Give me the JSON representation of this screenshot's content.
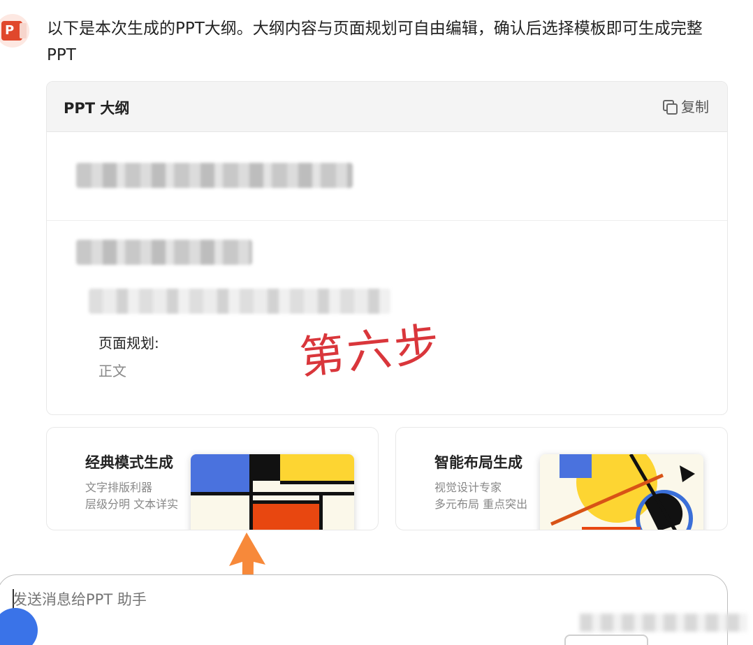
{
  "intro_text": "以下是本次生成的PPT大纲。大纲内容与页面规划可自由编辑，确认后选择模板即可生成完整PPT",
  "outline": {
    "title": "PPT 大纲",
    "copy_label": "复制",
    "page_plan_label": "页面规划:",
    "page_plan_value": "正文"
  },
  "annotation": "第六步",
  "modes": [
    {
      "title": "经典模式生成",
      "desc_line1": "文字排版利器",
      "desc_line2": "层级分明 文本详实"
    },
    {
      "title": "智能布局生成",
      "desc_line1": "视觉设计专家",
      "desc_line2": "多元布局 重点突出"
    }
  ],
  "composer": {
    "placeholder": "发送消息给PPT 助手"
  },
  "colors": {
    "annotation": "#d9363b",
    "arrow": "#f7893a",
    "mondrian_blue": "#4a72de",
    "mondrian_yellow": "#fdd532",
    "mondrian_red": "#e84710"
  }
}
